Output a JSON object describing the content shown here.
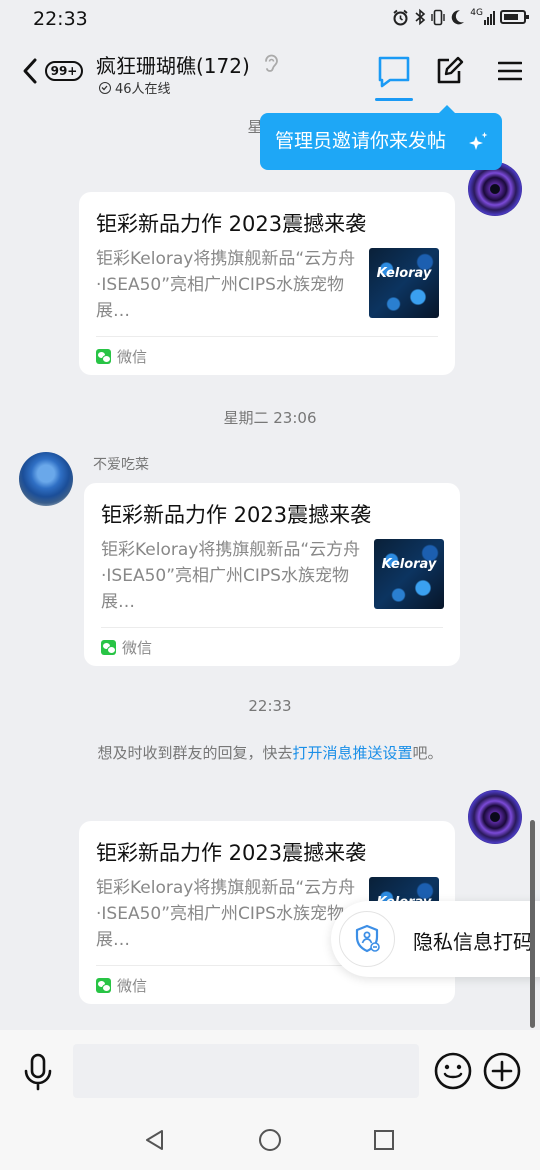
{
  "status_bar": {
    "time": "22:33",
    "icons": [
      "alarm-icon",
      "bluetooth-icon",
      "vibrate-icon",
      "moon-icon",
      "signal-4g-icon",
      "battery-icon"
    ],
    "network": "4G"
  },
  "header": {
    "unread_badge": "99+",
    "group_name": "疯狂珊瑚礁(172)",
    "online_count": "46人在线",
    "accent_color": "#1a9af5"
  },
  "tooltip": {
    "text": "管理员邀请你来发帖"
  },
  "messages": [
    {
      "timestamp": "星期二",
      "sender": "",
      "card": {
        "title": "钜彩新品力作 2023震撼来袭",
        "description": "钜彩Keloray将携旗舰新品“云方舟·ISEA50”亮相广州CIPS水族宠物展…",
        "thumb_logo": "Keloray",
        "source": "微信"
      }
    },
    {
      "timestamp": "星期二 23:06",
      "sender": "不爱吃菜",
      "card": {
        "title": "钜彩新品力作 2023震撼来袭",
        "description": "钜彩Keloray将携旗舰新品“云方舟·ISEA50”亮相广州CIPS水族宠物展…",
        "thumb_logo": "Keloray",
        "source": "微信"
      }
    },
    {
      "timestamp": "22:33",
      "sender": "",
      "card": {
        "title": "钜彩新品力作 2023震撼来袭",
        "description": "钜彩Keloray将携旗舰新品“云方舟·ISEA50”亮相广州CIPS水族宠物展…",
        "thumb_logo": "Keloray",
        "source": "微信"
      }
    }
  ],
  "notice": {
    "prefix": "想及时收到群友的回复，快去",
    "link": "打开消息推送设置",
    "suffix": "吧。"
  },
  "privacy": {
    "label": "隐私信息打码"
  },
  "input": {
    "placeholder": ""
  }
}
